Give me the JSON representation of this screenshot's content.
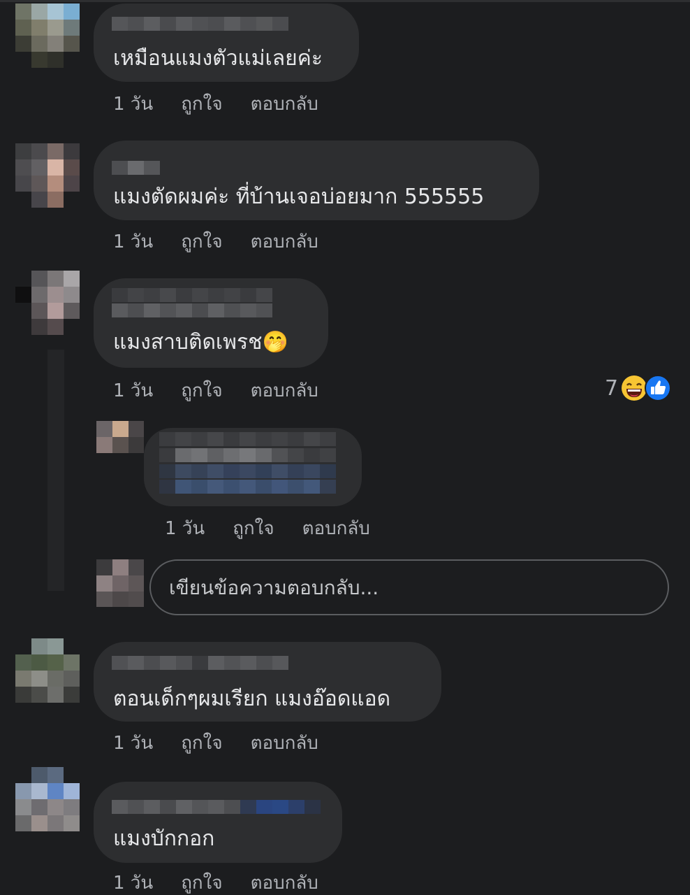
{
  "comments": [
    {
      "text": "เหมือนแมงตัวแม่เลยค่ะ",
      "time": "1 วัน",
      "like": "ถูกใจ",
      "reply": "ตอบกลับ"
    },
    {
      "text": "แมงตัดผมค่ะ ที่บ้านเจอบ่อยมาก 555555",
      "time": "1 วัน",
      "like": "ถูกใจ",
      "reply": "ตอบกลับ"
    },
    {
      "text": "แมงสาบติดเพรช",
      "emoji": "🤭",
      "time": "1 วัน",
      "like": "ถูกใจ",
      "reply": "ตอบกลับ",
      "reaction_count": "7",
      "reaction_icons": [
        "laughing-emoji-icon",
        "like-thumb-icon"
      ]
    },
    {
      "text": "ตอนเด็กๆผมเรียก แมงอ๊อดแอด",
      "time": "1 วัน",
      "like": "ถูกใจ",
      "reply": "ตอบกลับ"
    },
    {
      "text": "แมงบักกอก",
      "time": "1 วัน",
      "like": "ถูกใจ",
      "reply": "ตอบกลับ"
    }
  ],
  "nested_reply": {
    "time": "1 วัน",
    "like": "ถูกใจ",
    "reply": "ตอบกลับ"
  },
  "reply_input": {
    "placeholder": "เขียนข้อความตอบกลับ..."
  },
  "colors": {
    "background": "#1c1d1f",
    "bubble": "#2d2e30",
    "meta_text": "#b0b3b8",
    "like_blue": "#1877f2"
  }
}
